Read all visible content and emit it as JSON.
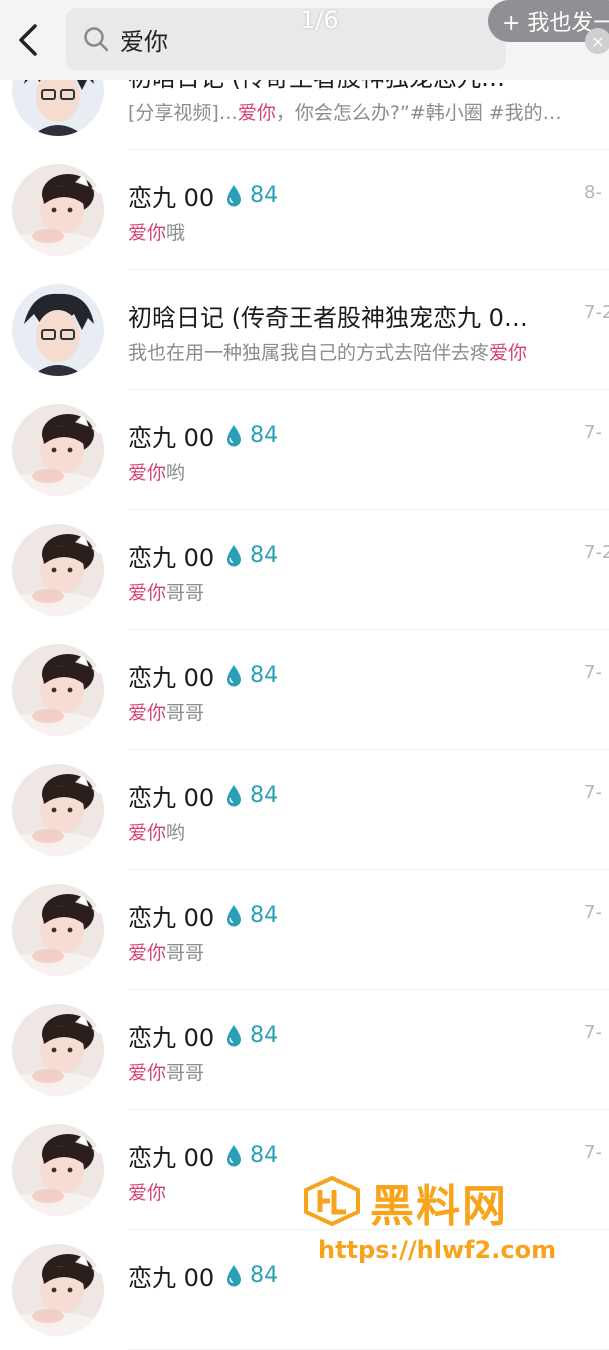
{
  "header": {
    "search_query": "爱你",
    "page_indicator": "1/6",
    "post_button": "+ 我也发一"
  },
  "results": [
    {
      "avatar": "boy",
      "name": "初晗日记 (传奇王者股神独宠恋九…",
      "badge": "",
      "snippet_pre": "[分享视频]…",
      "highlight": "爱你",
      "snippet_post": "，你会怎么办?”#韩小圈 #我的…",
      "date": ""
    },
    {
      "avatar": "girl",
      "name": "恋九 00",
      "badge": "84",
      "snippet_pre": "",
      "highlight": "爱你",
      "snippet_post": "哦",
      "date": "8-"
    },
    {
      "avatar": "boy",
      "name": "初晗日记 (传奇王者股神独宠恋九 0…",
      "badge": "",
      "snippet_pre": "我也在用一种独属我自己的方式去陪伴去疼",
      "highlight": "爱你",
      "snippet_post": "",
      "date": "7-2"
    },
    {
      "avatar": "girl",
      "name": "恋九 00",
      "badge": "84",
      "snippet_pre": "",
      "highlight": "爱你",
      "snippet_post": "哟",
      "date": "7-"
    },
    {
      "avatar": "girl",
      "name": "恋九 00",
      "badge": "84",
      "snippet_pre": "",
      "highlight": "爱你",
      "snippet_post": "哥哥",
      "date": "7-2"
    },
    {
      "avatar": "girl",
      "name": "恋九 00",
      "badge": "84",
      "snippet_pre": "",
      "highlight": "爱你",
      "snippet_post": "哥哥",
      "date": "7-"
    },
    {
      "avatar": "girl",
      "name": "恋九 00",
      "badge": "84",
      "snippet_pre": "",
      "highlight": "爱你",
      "snippet_post": "哟",
      "date": "7-"
    },
    {
      "avatar": "girl",
      "name": "恋九 00",
      "badge": "84",
      "snippet_pre": "",
      "highlight": "爱你",
      "snippet_post": "哥哥",
      "date": "7-"
    },
    {
      "avatar": "girl",
      "name": "恋九 00",
      "badge": "84",
      "snippet_pre": "",
      "highlight": "爱你",
      "snippet_post": "哥哥",
      "date": "7-"
    },
    {
      "avatar": "girl",
      "name": "恋九 00",
      "badge": "84",
      "snippet_pre": "",
      "highlight": "爱你",
      "snippet_post": "",
      "date": "7-"
    },
    {
      "avatar": "girl",
      "name": "恋九 00",
      "badge": "84",
      "snippet_pre": "",
      "highlight": "",
      "snippet_post": "",
      "date": ""
    }
  ],
  "watermark": {
    "title": "黑料网",
    "url": "https://hlwf2.com"
  },
  "colors": {
    "highlight": "#d6436f",
    "badge": "#2aa0b8",
    "watermark": "#f7a41c"
  },
  "icons": [
    "back-arrow-icon",
    "search-icon",
    "water-drop-icon",
    "close-icon"
  ]
}
